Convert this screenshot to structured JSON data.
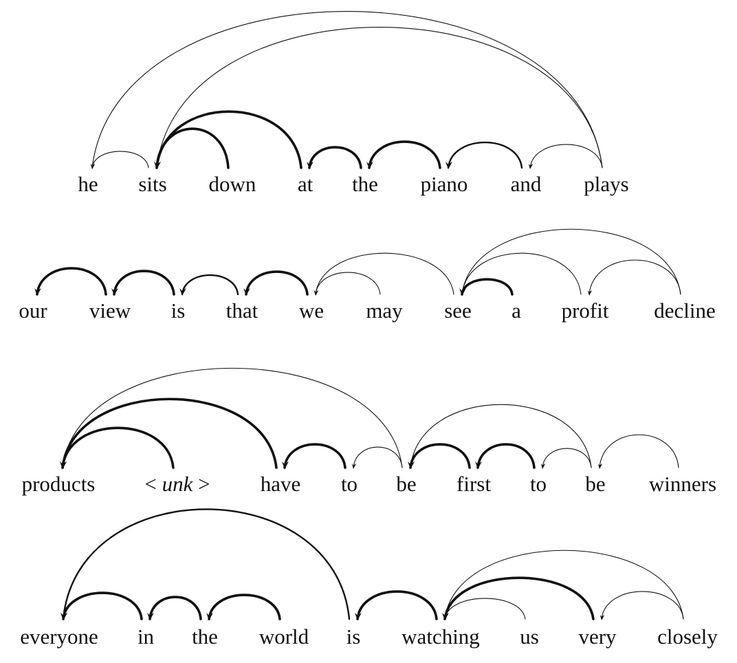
{
  "figure": {
    "description": "Dependency-style arc diagrams over four sentences; arc thickness indicates strength",
    "sentences": [
      {
        "words": [
          "he",
          "sits",
          "down",
          "at",
          "the",
          "piano",
          "and",
          "plays"
        ],
        "arcs": [
          {
            "from": 7,
            "to": 0,
            "weight": "thin"
          },
          {
            "from": 7,
            "to": 1,
            "weight": "thin"
          },
          {
            "from": 1,
            "to": 0,
            "weight": "thin"
          },
          {
            "from": 2,
            "to": 1,
            "weight": "thick"
          },
          {
            "from": 3,
            "to": 1,
            "weight": "thick"
          },
          {
            "from": 4,
            "to": 3,
            "weight": "thick"
          },
          {
            "from": 5,
            "to": 4,
            "weight": "thick"
          },
          {
            "from": 6,
            "to": 5,
            "weight": "medium"
          },
          {
            "from": 7,
            "to": 6,
            "weight": "thin"
          }
        ]
      },
      {
        "words": [
          "our",
          "view",
          "is",
          "that",
          "we",
          "may",
          "see",
          "a",
          "profit",
          "decline"
        ],
        "arcs": [
          {
            "from": 1,
            "to": 0,
            "weight": "thick"
          },
          {
            "from": 2,
            "to": 1,
            "weight": "thick"
          },
          {
            "from": 3,
            "to": 2,
            "weight": "medium"
          },
          {
            "from": 4,
            "to": 3,
            "weight": "thick"
          },
          {
            "from": 5,
            "to": 4,
            "weight": "thin"
          },
          {
            "from": 6,
            "to": 4,
            "weight": "thin"
          },
          {
            "from": 7,
            "to": 6,
            "weight": "thick"
          },
          {
            "from": 8,
            "to": 6,
            "weight": "thin"
          },
          {
            "from": 9,
            "to": 6,
            "weight": "thin"
          },
          {
            "from": 9,
            "to": 8,
            "weight": "thin"
          }
        ]
      },
      {
        "words": [
          "products",
          "< unk >",
          "have",
          "to",
          "be",
          "first",
          "to",
          "be",
          "winners"
        ],
        "italic_word_index": 1,
        "arcs": [
          {
            "from": 1,
            "to": 0,
            "weight": "thick"
          },
          {
            "from": 2,
            "to": 0,
            "weight": "thick"
          },
          {
            "from": 4,
            "to": 0,
            "weight": "thin"
          },
          {
            "from": 3,
            "to": 2,
            "weight": "thick"
          },
          {
            "from": 4,
            "to": 3,
            "weight": "thin"
          },
          {
            "from": 5,
            "to": 4,
            "weight": "thick"
          },
          {
            "from": 6,
            "to": 5,
            "weight": "thick"
          },
          {
            "from": 7,
            "to": 6,
            "weight": "thin"
          },
          {
            "from": 7,
            "to": 4,
            "weight": "thin"
          },
          {
            "from": 8,
            "to": 7,
            "weight": "thin"
          }
        ]
      },
      {
        "words": [
          "everyone",
          "in",
          "the",
          "world",
          "is",
          "watching",
          "us",
          "very",
          "closely"
        ],
        "arcs": [
          {
            "from": 1,
            "to": 0,
            "weight": "thick"
          },
          {
            "from": 4,
            "to": 0,
            "weight": "medium"
          },
          {
            "from": 2,
            "to": 1,
            "weight": "thick"
          },
          {
            "from": 3,
            "to": 2,
            "weight": "thick"
          },
          {
            "from": 5,
            "to": 4,
            "weight": "thick"
          },
          {
            "from": 6,
            "to": 5,
            "weight": "thin"
          },
          {
            "from": 7,
            "to": 5,
            "weight": "thick"
          },
          {
            "from": 8,
            "to": 5,
            "weight": "thin"
          },
          {
            "from": 8,
            "to": 7,
            "weight": "thin"
          }
        ]
      }
    ]
  }
}
